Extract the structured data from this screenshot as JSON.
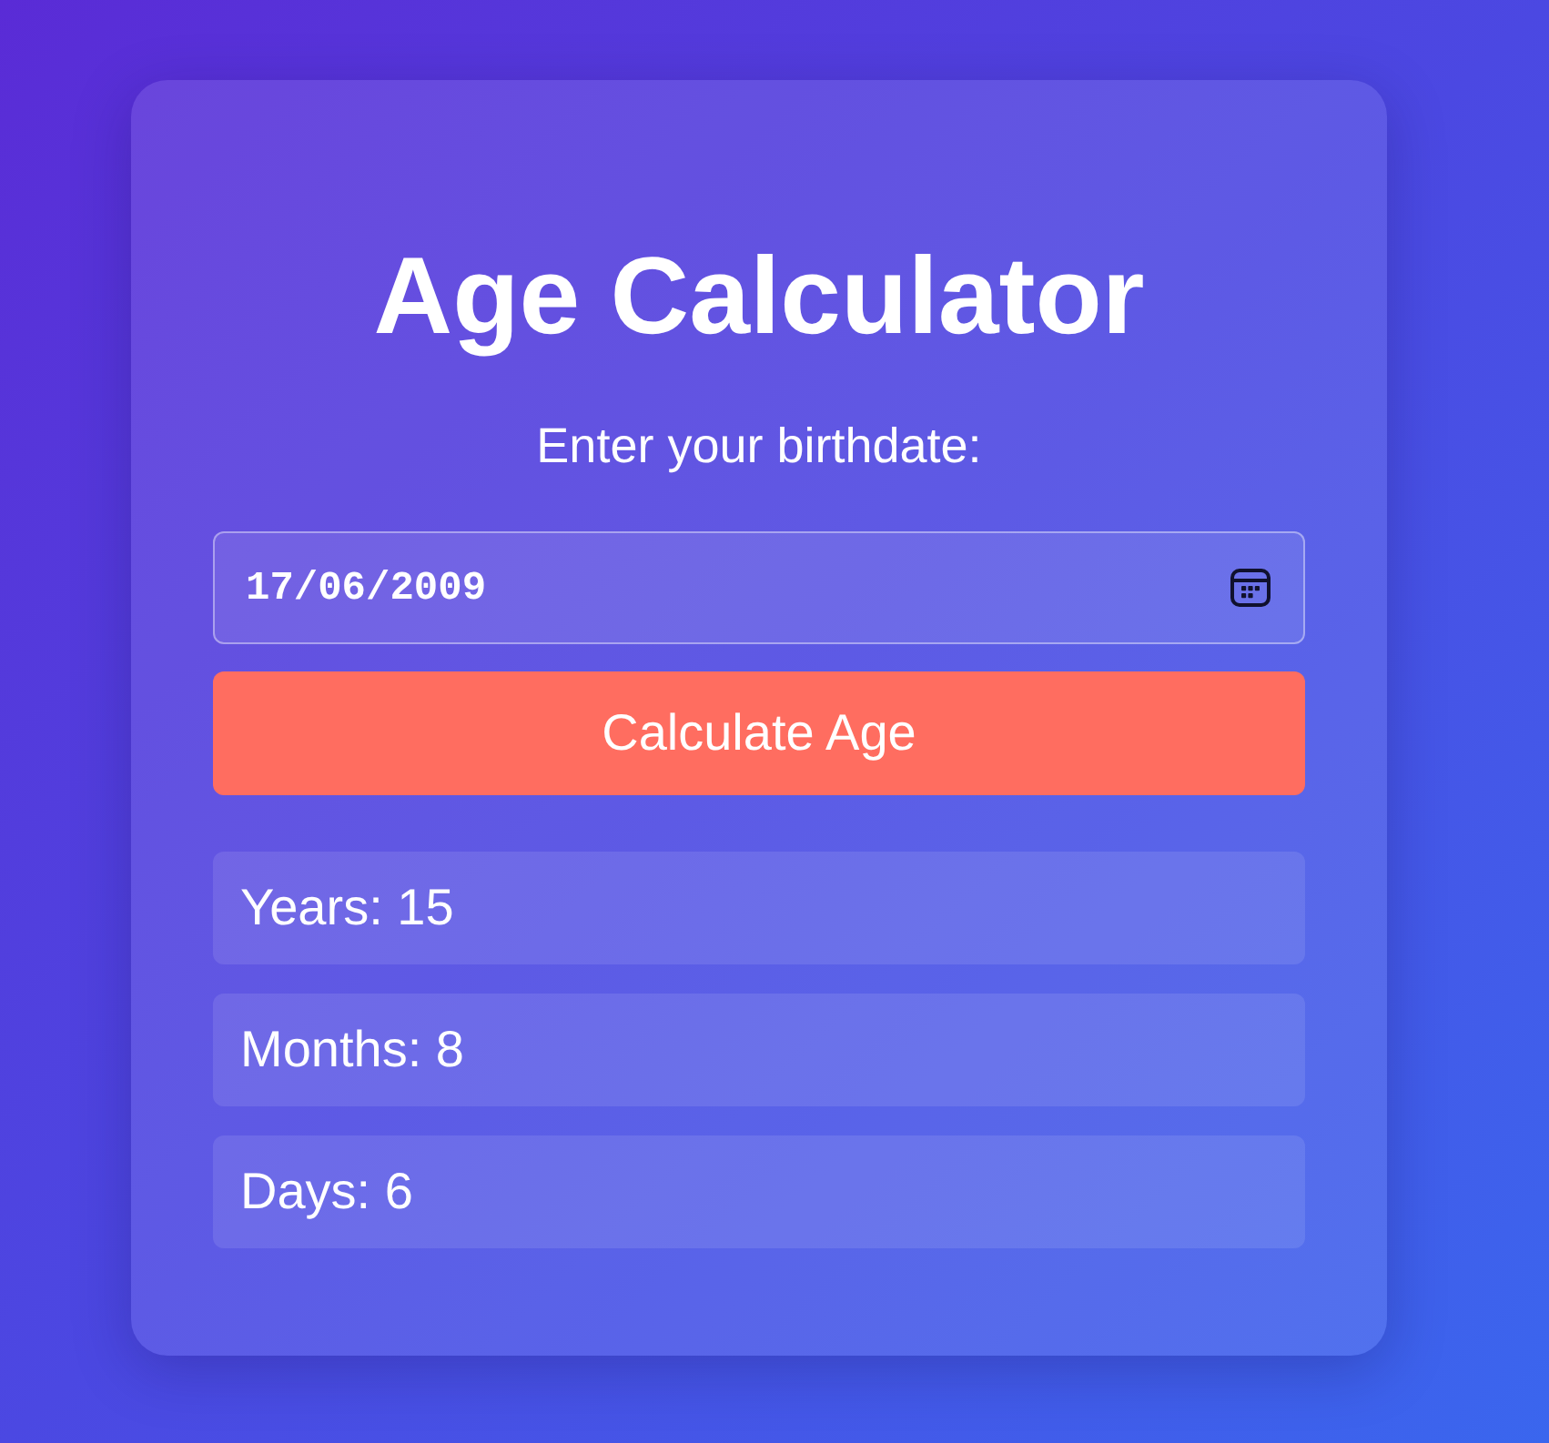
{
  "title": "Age Calculator",
  "prompt": "Enter your birthdate:",
  "date_input": {
    "value": "17/06/2009"
  },
  "button": {
    "label": "Calculate Age"
  },
  "results": [
    "Years: 15",
    "Months: 8",
    "Days: 6"
  ]
}
